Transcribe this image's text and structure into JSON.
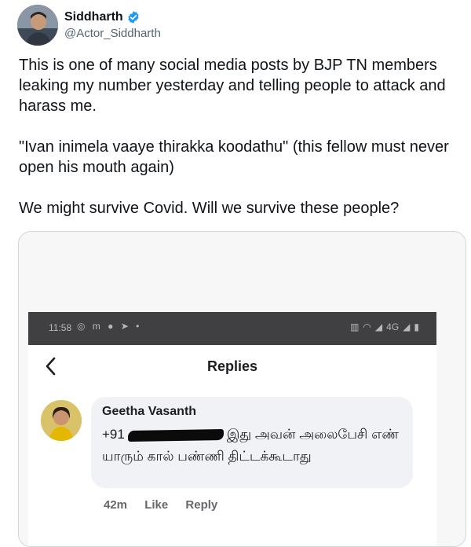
{
  "tweet": {
    "author_name": "Siddharth",
    "handle": "@Actor_Siddharth",
    "verified": true,
    "paragraphs": [
      "This is one of many social media posts by BJP TN members leaking my number yesterday and telling people to attack and harass me.",
      "\"Ivan inimela vaaye thirakka koodathu\" (this fellow must never open his mouth again)",
      "We might survive Covid. Will we survive these people?"
    ]
  },
  "phone": {
    "status_time": "11:58",
    "status_left_icons": "◎ m ● ➤ •",
    "network": "4G",
    "page_title": "Replies"
  },
  "comment": {
    "name": "Geetha Vasanth",
    "text_prefix": "+91",
    "text_rest": "இது அவன் அலைபேசி எண் யாரும் கால் பண்ணி திட்டக்கூடாது",
    "time": "42m",
    "like": "Like",
    "reply": "Reply"
  },
  "colors": {
    "verified_blue": "#1d9bf0",
    "status_bar": "#404042",
    "bubble": "#f0f2f5"
  },
  "icons": [
    "verified-badge-icon",
    "back-chevron-icon",
    "wifi-icon",
    "signal-icon",
    "battery-icon"
  ]
}
